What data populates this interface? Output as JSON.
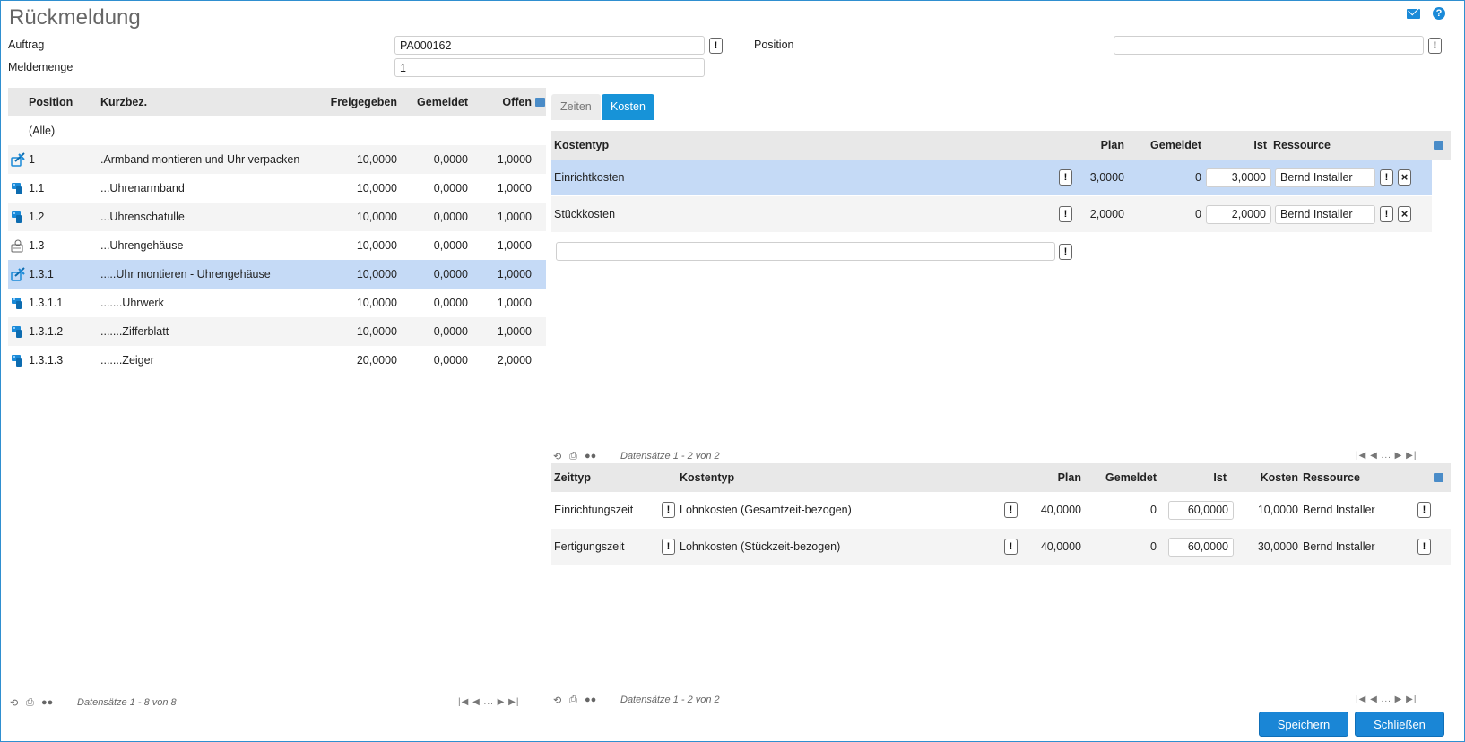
{
  "title": "Rückmeldung",
  "form": {
    "auftrag_label": "Auftrag",
    "auftrag_value": "PA000162",
    "meldemenge_label": "Meldemenge",
    "meldemenge_value": "1",
    "position_label": "Position",
    "position_value": ""
  },
  "left_grid": {
    "headers": {
      "position": "Position",
      "kurzbez": "Kurzbez.",
      "freigegeben": "Freigegeben",
      "gemeldet": "Gemeldet",
      "offen": "Offen"
    },
    "all_label": "(Alle)",
    "rows": [
      {
        "icon": "assembly-icon",
        "position": "1",
        "kurzbez": ".Armband montieren und Uhr verpacken - Arm",
        "freigegeben": "10,0000",
        "gemeldet": "0,0000",
        "offen": "1,0000"
      },
      {
        "icon": "part-icon",
        "position": "1.1",
        "kurzbez": "...Uhrenarmband",
        "freigegeben": "10,0000",
        "gemeldet": "0,0000",
        "offen": "1,0000"
      },
      {
        "icon": "part-icon",
        "position": "1.2",
        "kurzbez": "...Uhrenschatulle",
        "freigegeben": "10,0000",
        "gemeldet": "0,0000",
        "offen": "1,0000"
      },
      {
        "icon": "subassembly-icon",
        "position": "1.3",
        "kurzbez": "...Uhrengehäuse",
        "freigegeben": "10,0000",
        "gemeldet": "0,0000",
        "offen": "1,0000"
      },
      {
        "icon": "assembly-icon",
        "position": "1.3.1",
        "kurzbez": ".....Uhr montieren - Uhrengehäuse",
        "freigegeben": "10,0000",
        "gemeldet": "0,0000",
        "offen": "1,0000"
      },
      {
        "icon": "part-icon",
        "position": "1.3.1.1",
        "kurzbez": ".......Uhrwerk",
        "freigegeben": "10,0000",
        "gemeldet": "0,0000",
        "offen": "1,0000"
      },
      {
        "icon": "part-icon",
        "position": "1.3.1.2",
        "kurzbez": ".......Zifferblatt",
        "freigegeben": "10,0000",
        "gemeldet": "0,0000",
        "offen": "1,0000"
      },
      {
        "icon": "part-icon",
        "position": "1.3.1.3",
        "kurzbez": ".......Zeiger",
        "freigegeben": "20,0000",
        "gemeldet": "0,0000",
        "offen": "2,0000"
      }
    ],
    "pager_text": "Datensätze 1 - 8 von 8"
  },
  "tabs": {
    "zeiten": "Zeiten",
    "kosten": "Kosten"
  },
  "kosten_grid": {
    "headers": {
      "kostentyp": "Kostentyp",
      "plan": "Plan",
      "gemeldet": "Gemeldet",
      "ist": "Ist",
      "ressource": "Ressource"
    },
    "rows": [
      {
        "kostentyp": "Einrichtkosten",
        "plan": "3,0000",
        "gemeldet": "0",
        "ist": "3,0000",
        "ressource": "Bernd Installer"
      },
      {
        "kostentyp": "Stückkosten",
        "plan": "2,0000",
        "gemeldet": "0",
        "ist": "2,0000",
        "ressource": "Bernd Installer"
      }
    ],
    "new_value": "",
    "pager_text": "Datensätze 1 - 2 von 2"
  },
  "zeit_grid": {
    "headers": {
      "zeittyp": "Zeittyp",
      "kostentyp": "Kostentyp",
      "plan": "Plan",
      "gemeldet": "Gemeldet",
      "ist": "Ist",
      "kosten": "Kosten",
      "ressource": "Ressource"
    },
    "rows": [
      {
        "zeittyp": "Einrichtungszeit",
        "kostentyp": "Lohnkosten (Gesamtzeit-bezogen)",
        "plan": "40,0000",
        "gemeldet": "0",
        "ist": "60,0000",
        "kosten": "10,0000",
        "ressource": "Bernd Installer"
      },
      {
        "zeittyp": "Fertigungszeit",
        "kostentyp": "Lohnkosten (Stückzeit-bezogen)",
        "plan": "40,0000",
        "gemeldet": "0",
        "ist": "60,0000",
        "kosten": "30,0000",
        "ressource": "Bernd Installer"
      }
    ],
    "pager_text": "Datensätze 1 - 2 von 2"
  },
  "pager_nav": "... ",
  "buttons": {
    "save": "Speichern",
    "close": "Schließen"
  },
  "colors": {
    "accent": "#1793d8",
    "selected_row": "#c5daf6",
    "header_bg": "#e8e8e8"
  }
}
